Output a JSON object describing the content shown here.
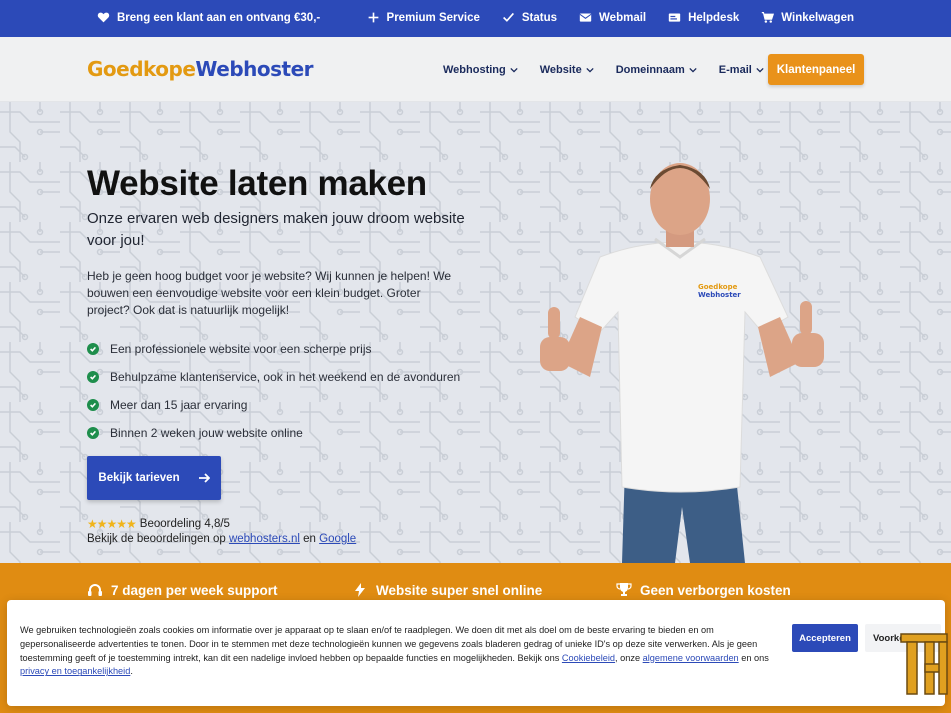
{
  "topbar": {
    "promo": "Breng een klant aan en ontvang €30,-",
    "links": [
      {
        "label": "Premium Service",
        "icon": "plus-icon"
      },
      {
        "label": "Status",
        "icon": "check-icon"
      },
      {
        "label": "Webmail",
        "icon": "envelope-icon"
      },
      {
        "label": "Helpdesk",
        "icon": "helpdesk-icon"
      },
      {
        "label": "Winkelwagen",
        "icon": "cart-icon"
      }
    ]
  },
  "header": {
    "logo_part1": "Goedkope",
    "logo_part2": "Webhoster",
    "nav": [
      "Webhosting",
      "Website",
      "Domeinnaam",
      "E-mail"
    ],
    "cta": "Klantenpaneel"
  },
  "hero": {
    "title": "Website laten maken",
    "subtitle": "Onze ervaren web designers maken jouw droom website voor jou!",
    "paragraph": "Heb je geen hoog budget voor je website? Wij kunnen je helpen! We bouwen een eenvoudige website voor een klein budget. Groter project? Ook dat is natuurlijk mogelijk!",
    "checks": [
      "Een professionele website voor een scherpe prijs",
      "Behulpzame klantenservice, ook in het weekend en de avonduren",
      "Meer dan 15 jaar ervaring",
      "Binnen 2 weken jouw website online"
    ],
    "button": "Bekijk tarieven",
    "stars": "★★★★★",
    "rating_text": "Beoordeling 4,8/5",
    "reviews_prefix": "Bekijk de beoordelingen op",
    "reviews_link1": "webhosters.nl",
    "reviews_and": "en",
    "reviews_link2": "Google",
    "shirt_logo_1": "Goedkope",
    "shirt_logo_2": "Webhoster"
  },
  "features": [
    {
      "label": "7 dagen per week support",
      "icon": "headset-icon"
    },
    {
      "label": "Website super snel online",
      "icon": "bolt-icon"
    },
    {
      "label": "Geen verborgen kosten",
      "icon": "trophy-icon"
    }
  ],
  "cookie": {
    "text_main": "We gebruiken technologieën zoals cookies om informatie over je apparaat op te slaan en/of te raadplegen. We doen dit met als doel om de beste ervaring te bieden en om gepersonaliseerde advertenties te tonen. Door in te stemmen met deze technologieën kunnen we gegevens zoals bladeren gedrag of unieke ID's op deze site verwerken. Als je geen toestemming geeft of je toestemming intrekt, kan dit een nadelige invloed hebben op bepaalde functies en mogelijkheden. Bekijk ons",
    "link_cookie": "Cookiebeleid",
    "text_mid": ", onze",
    "link_terms": "algemene voorwaarden",
    "text_and": "en ons",
    "link_privacy": "privacy en toegankelijkheid",
    "text_end": ".",
    "accept": "Accepteren",
    "preferences": "Voorkeuren"
  },
  "colors": {
    "primary_blue": "#2c4ab8",
    "orange": "#e08c12",
    "check_green": "#1e8e4c",
    "star_yellow": "#f0b41a"
  }
}
